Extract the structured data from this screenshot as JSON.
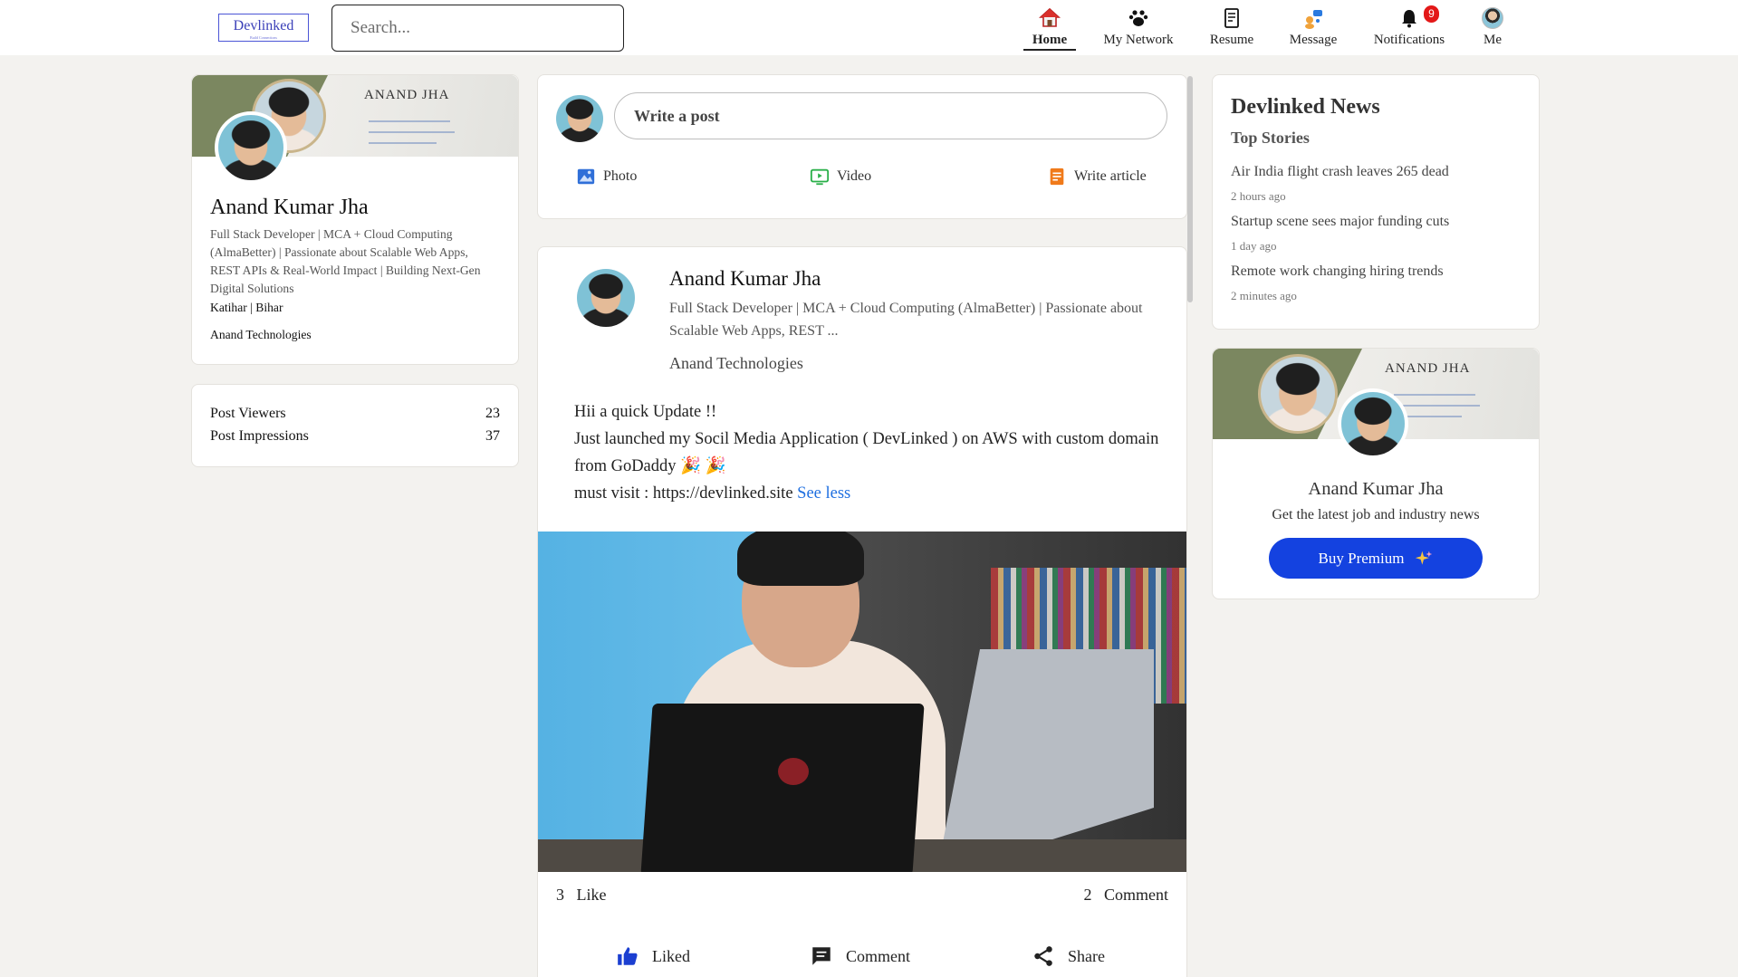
{
  "brand": {
    "name": "Devlinked",
    "tagline": "Build Connections"
  },
  "search": {
    "placeholder": "Search..."
  },
  "nav": {
    "items": [
      {
        "label": "Home",
        "icon": "home-icon",
        "active": true
      },
      {
        "label": "My Network",
        "icon": "network-icon"
      },
      {
        "label": "Resume",
        "icon": "resume-icon"
      },
      {
        "label": "Message",
        "icon": "message-icon"
      },
      {
        "label": "Notifications",
        "icon": "bell-icon"
      },
      {
        "label": "Me",
        "icon": "avatar"
      }
    ],
    "notification_count": "9"
  },
  "profile": {
    "cover_name": "ANAND JHA",
    "name": "Anand Kumar Jha",
    "headline": "Full Stack Developer | MCA + Cloud Computing (AlmaBetter) | Passionate about Scalable Web Apps, REST APIs & Real-World Impact | Building Next-Gen Digital Solutions",
    "location": "Katihar | Bihar",
    "company": "Anand Technologies"
  },
  "stats": [
    {
      "label": "Post Viewers",
      "value": "23"
    },
    {
      "label": "Post Impressions",
      "value": "37"
    }
  ],
  "composer": {
    "placeholder": "Write a post",
    "actions": [
      {
        "label": "Photo",
        "icon": "photo-icon",
        "color": "#2f6fd8"
      },
      {
        "label": "Video",
        "icon": "video-icon",
        "color": "#2bb04a"
      },
      {
        "label": "Write article",
        "icon": "article-icon",
        "color": "#f07a1a"
      }
    ]
  },
  "post": {
    "author": "Anand Kumar Jha",
    "headline": "Full Stack Developer | MCA + Cloud Computing (AlmaBetter) | Passionate about Scalable Web Apps, REST  ...",
    "company": "Anand Technologies",
    "body_lines": [
      "Hii a quick Update !!",
      "Just launched my Socil Media Application ( DevLinked ) on AWS with custom domain from GoDaddy 🎉 🎉",
      "must visit : https://devlinked.site"
    ],
    "see_less": "See less",
    "like_count": "3",
    "like_count_label": "Like",
    "comment_count": "2",
    "comment_count_label": "Comment",
    "actions": [
      {
        "label": "Liked",
        "icon": "thumbs-up-icon"
      },
      {
        "label": "Comment",
        "icon": "comment-icon"
      },
      {
        "label": "Share",
        "icon": "share-icon"
      }
    ]
  },
  "news": {
    "title": "Devlinked News",
    "subtitle": "Top Stories",
    "items": [
      {
        "headline": "Air India flight crash leaves 265 dead",
        "time": "2 hours ago"
      },
      {
        "headline": "Startup scene sees major funding cuts",
        "time": "1 day ago"
      },
      {
        "headline": "Remote work changing hiring trends",
        "time": "2 minutes ago"
      }
    ]
  },
  "premium": {
    "cover_name": "ANAND JHA",
    "name": "Anand Kumar Jha",
    "subtitle": "Get the latest job and industry news",
    "button_label": "Buy Premium",
    "button_icon": "sparkles-icon",
    "accent": "#1442e0"
  }
}
